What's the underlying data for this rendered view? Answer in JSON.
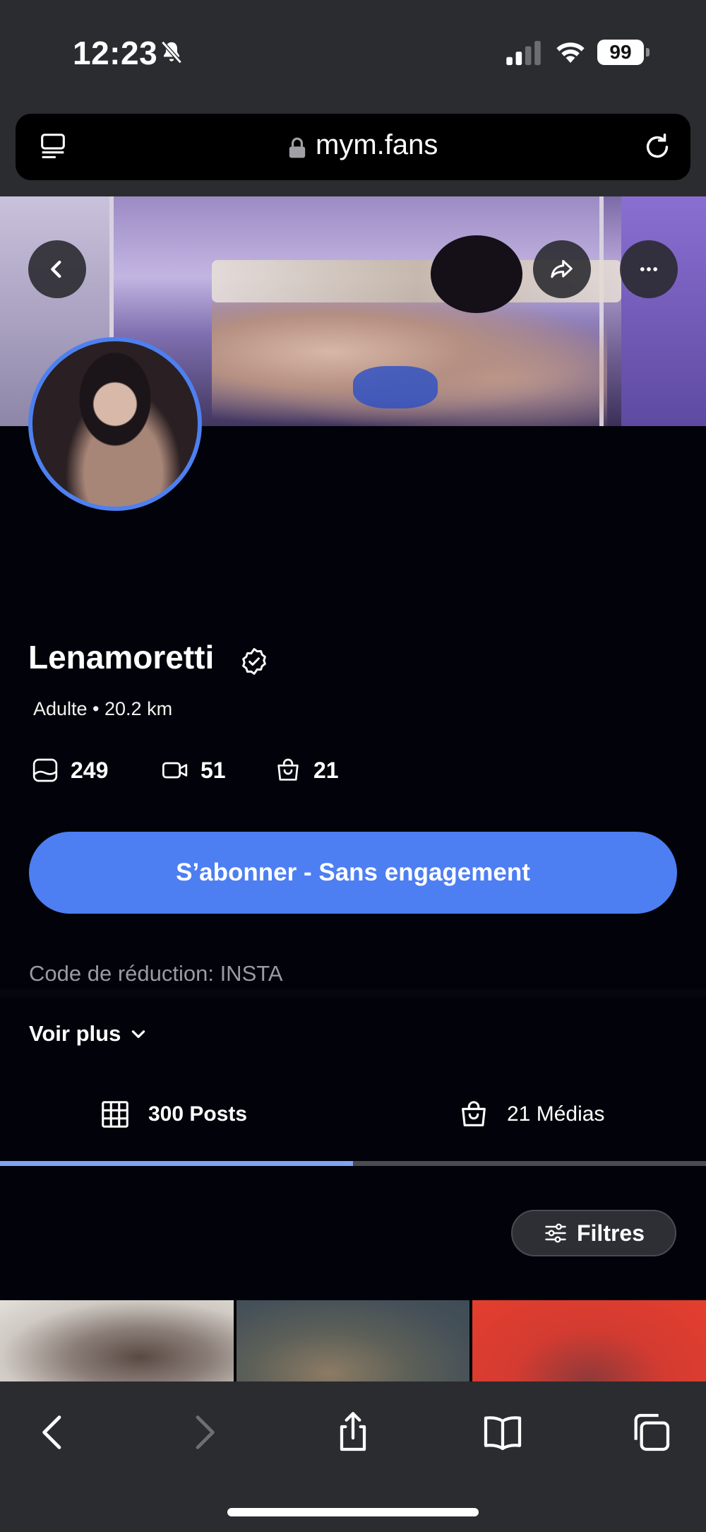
{
  "status_bar": {
    "time": "12:23",
    "battery": "99",
    "icons": [
      "bell-slash-icon",
      "cellular-signal-icon",
      "wifi-icon",
      "battery-icon"
    ]
  },
  "browser": {
    "url": "mym.fans",
    "icons": [
      "tabs-overview-icon",
      "lock-icon",
      "reload-icon"
    ]
  },
  "header_buttons": [
    "back-arrow-icon",
    "share-icon",
    "more-icon"
  ],
  "profile": {
    "name": "Lenamoretti",
    "meta": "Adulte • 20.2 km",
    "stats": {
      "photos": "249",
      "videos": "51",
      "media": "21"
    },
    "subscribe_label": "S’abonner - Sans engagement",
    "promo": "Code de réduction: INSTA",
    "see_more": "Voir plus"
  },
  "tabs": {
    "posts": "300 Posts",
    "medias": "21 Médias",
    "active": "posts"
  },
  "filters_label": "Filtres",
  "colors": {
    "accent": "#4d7ef2",
    "background": "#02030a",
    "chrome": "#2b2c30",
    "tab_indicator": "#7ea3f7"
  },
  "toolbar_icons": [
    "chevron-left-icon",
    "chevron-right-icon",
    "share-icon",
    "bookmarks-icon",
    "tabs-icon"
  ]
}
